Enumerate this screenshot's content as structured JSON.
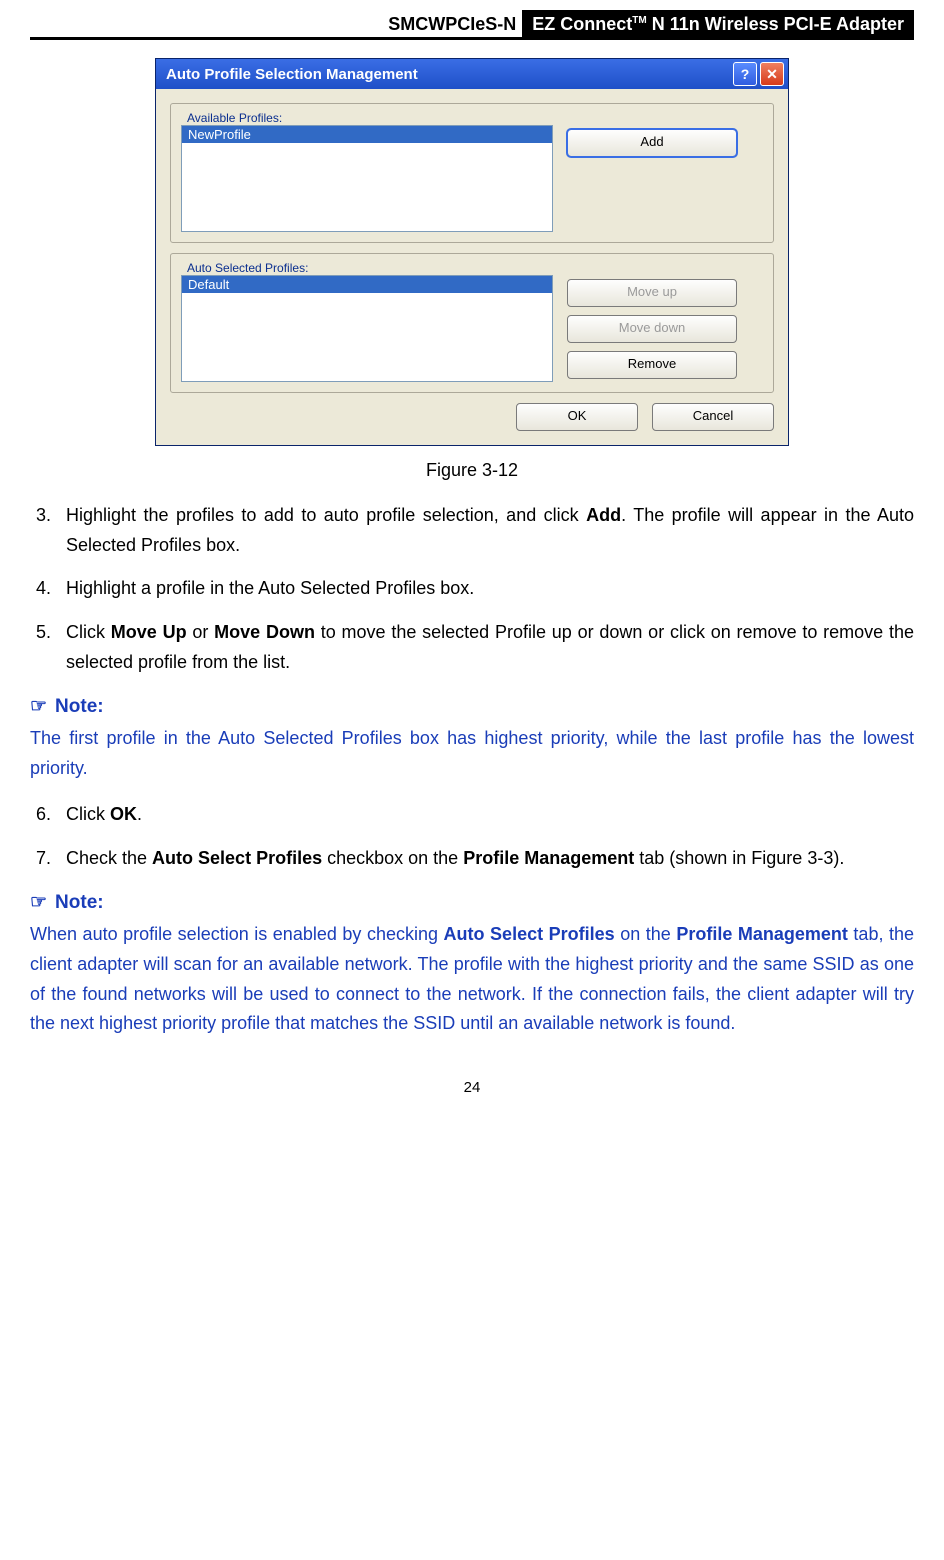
{
  "header": {
    "left": "SMCWPCIeS-N",
    "right_prefix": "EZ Connect",
    "right_tm": "TM",
    "right_suffix": " N 11n Wireless PCI-E Adapter"
  },
  "dialog": {
    "title": "Auto Profile Selection Management",
    "help_symbol": "?",
    "close_symbol": "✕",
    "group1_label": "Available Profiles:",
    "group1_items": [
      "NewProfile"
    ],
    "group2_label": "Auto Selected Profiles:",
    "group2_items": [
      "Default"
    ],
    "btn_add": "Add",
    "btn_moveup": "Move up",
    "btn_movedown": "Move down",
    "btn_remove": "Remove",
    "btn_ok": "OK",
    "btn_cancel": "Cancel"
  },
  "figure_caption": "Figure 3-12",
  "steps_a": [
    {
      "n": "3.",
      "text_pre": "Highlight the profiles to add to auto profile selection, and click ",
      "bold": "Add",
      "text_post": ". The profile will appear in the Auto Selected Profiles box."
    },
    {
      "n": "4.",
      "text_pre": "Highlight a profile in the Auto Selected Profiles box.",
      "bold": "",
      "text_post": ""
    },
    {
      "n": "5.",
      "text_pre": "Click ",
      "bold": "Move Up",
      "mid": " or ",
      "bold2": "Move Down",
      "text_post": " to move the selected Profile up or down or click on remove to remove the selected profile from the list."
    }
  ],
  "note1_head": "Note:",
  "note1_body": "The first profile in the Auto Selected Profiles box has highest priority, while the last profile has the lowest priority.",
  "steps_b": [
    {
      "n": "6.",
      "text_pre": "Click ",
      "bold": "OK",
      "text_post": "."
    },
    {
      "n": "7.",
      "text_pre": "Check the ",
      "bold": "Auto Select Profiles",
      "mid": " checkbox on the ",
      "bold2": "Profile Management",
      "text_post": " tab (shown in Figure 3-3)."
    }
  ],
  "note2_head": "Note:",
  "note2_body_pre": "When auto profile selection is enabled by checking ",
  "note2_bold1": "Auto Select Profiles",
  "note2_mid1": " on the ",
  "note2_bold2": "Profile Management",
  "note2_body_post": " tab, the client adapter will scan for an available network. The profile with the highest priority and the same SSID as one of the found networks will be used to connect to the network. If the connection fails, the client adapter will try the next highest priority profile that matches the SSID until an available network is found.",
  "page_number": "24"
}
